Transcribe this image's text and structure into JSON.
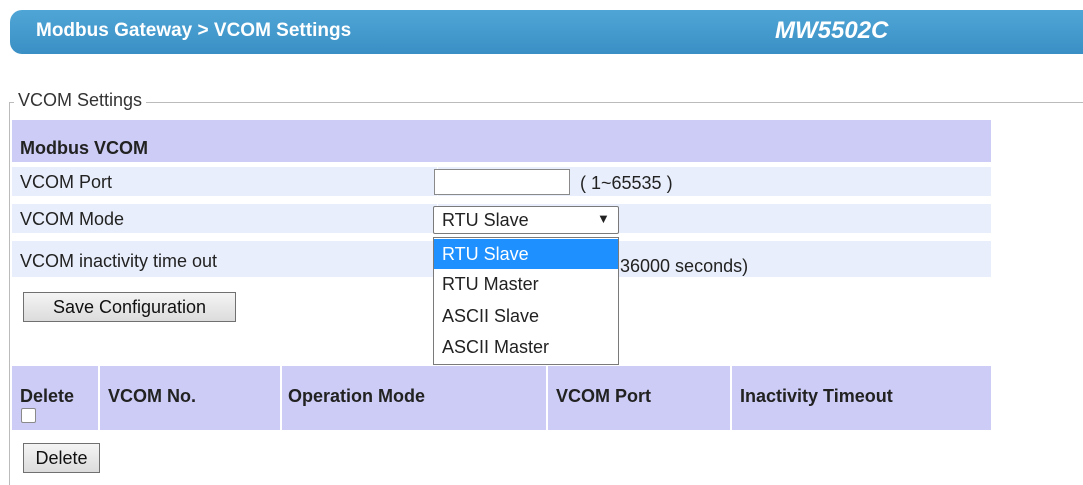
{
  "header": {
    "path": "Modbus Gateway > VCOM Settings",
    "model": "MW5502C"
  },
  "fieldset_legend": "VCOM Settings",
  "section_title": "Modbus VCOM",
  "rows": [
    {
      "label": "VCOM Port",
      "input_value": "",
      "range": "( 1~65535 )"
    },
    {
      "label": "VCOM Mode",
      "selected": "RTU Slave",
      "arrow": "▼"
    },
    {
      "label": "VCOM inactivity time out",
      "range_partial": "36000 seconds)"
    }
  ],
  "dropdown_options": [
    "RTU Slave",
    "RTU Master",
    "ASCII Slave",
    "ASCII Master"
  ],
  "save_button": "Save Configuration",
  "list_headers": [
    "Delete",
    "VCOM No.",
    "Operation Mode",
    "VCOM Port",
    "Inactivity Timeout"
  ],
  "delete_button": "Delete",
  "colors": {
    "header": "#3a8fc4",
    "section": "#ccccf6",
    "row": "#e8eefb",
    "selected": "#1e90ff"
  }
}
